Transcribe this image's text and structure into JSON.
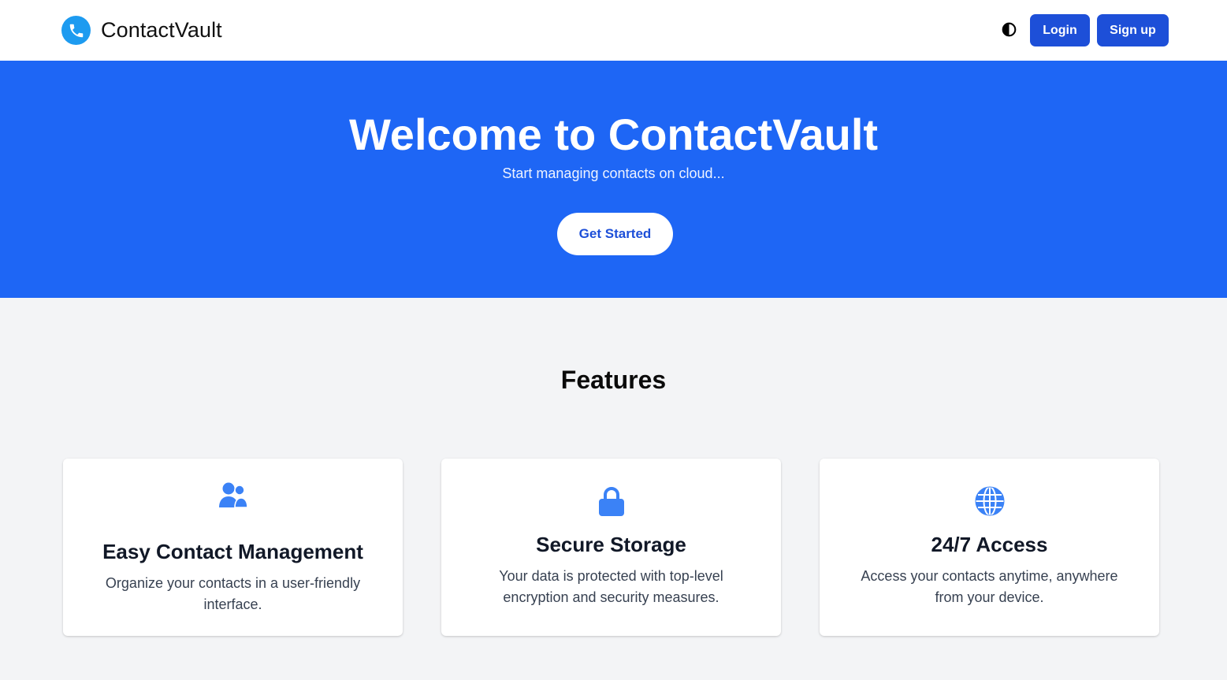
{
  "navbar": {
    "brand_name": "ContactVault",
    "brand_icon": "phone-icon",
    "theme_toggle_icon": "contrast-icon",
    "login_label": "Login",
    "signup_label": "Sign up"
  },
  "hero": {
    "title": "Welcome to ContactVault",
    "subtitle": "Start managing contacts on cloud...",
    "cta_label": "Get Started"
  },
  "features": {
    "heading": "Features",
    "items": [
      {
        "icon": "users-icon",
        "title": "Easy Contact Management",
        "description": "Organize your contacts in a user-friendly interface."
      },
      {
        "icon": "lock-icon",
        "title": "Secure Storage",
        "description": "Your data is protected with top-level encryption and security measures."
      },
      {
        "icon": "globe-icon",
        "title": "24/7 Access",
        "description": "Access your contacts anytime, anywhere from your device."
      }
    ]
  },
  "colors": {
    "primary_button": "#1d4fd8",
    "hero_background": "#1e66f5",
    "logo_circle": "#1d9bf0",
    "feature_icon": "#3b82f6",
    "page_background": "#f3f4f6"
  }
}
